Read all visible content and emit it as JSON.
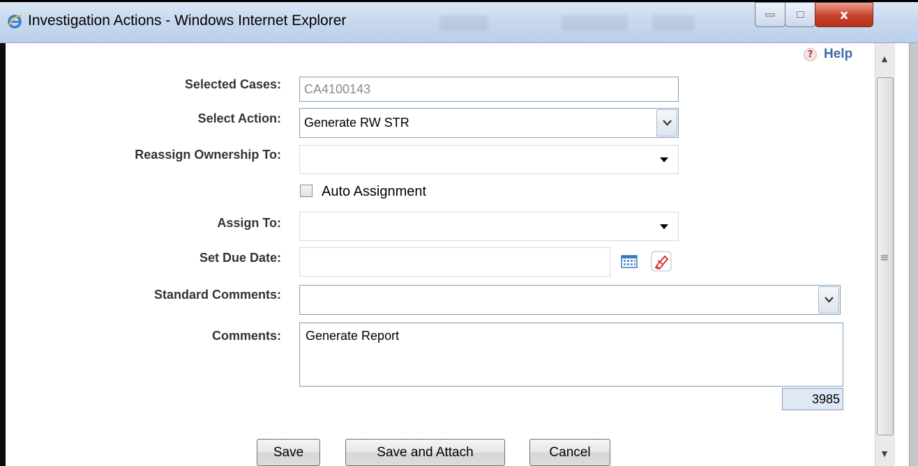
{
  "window": {
    "title": "Investigation Actions - Windows Internet Explorer",
    "close_glyph": "x"
  },
  "help": {
    "icon": "?",
    "label": "Help"
  },
  "form": {
    "selected_cases": {
      "label": "Selected Cases:",
      "value": "CA4100143"
    },
    "select_action": {
      "label": "Select Action:",
      "value": "Generate RW STR"
    },
    "reassign_ownership": {
      "label": "Reassign Ownership To:",
      "value": ""
    },
    "auto_assignment": {
      "label": "Auto Assignment",
      "checked": false
    },
    "assign_to": {
      "label": "Assign To:",
      "value": ""
    },
    "due_date": {
      "label": "Set Due Date:",
      "value": ""
    },
    "standard_comments": {
      "label": "Standard Comments:",
      "value": ""
    },
    "comments": {
      "label": "Comments:",
      "value": "Generate Report",
      "remaining_chars": "3985"
    }
  },
  "buttons": {
    "save": "Save",
    "save_and_attach": "Save and Attach",
    "cancel": "Cancel"
  },
  "scrollbar": {
    "up": "▲",
    "down": "▼",
    "grip": "≡"
  },
  "colors": {
    "label_text": "#333333",
    "help_link": "#3b6aa8",
    "input_border": "#7f9db9",
    "counter_bg": "#dfe8f4",
    "close_button": "#c8432b"
  }
}
